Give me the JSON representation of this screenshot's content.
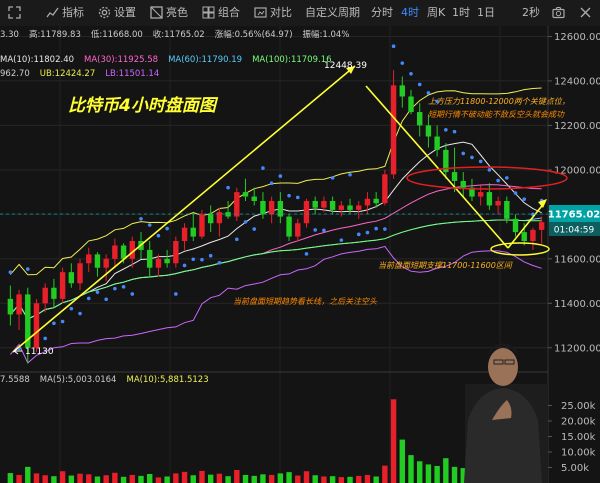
{
  "toolbar": {
    "indicators": "指标",
    "settings": "设置",
    "theme": "亮色",
    "combo": "组合",
    "compare": "对比",
    "custom_period": "自定义周期",
    "periods": [
      "分时",
      "4时",
      "周K",
      "1时",
      "1日"
    ],
    "active_period": "4时",
    "refresh": "2秒"
  },
  "info_line1": [
    {
      "text": "3.30",
      "color": "#cccccc"
    },
    {
      "text": "高:11789.83",
      "color": "#cccccc"
    },
    {
      "text": "低:11668.00",
      "color": "#cccccc"
    },
    {
      "text": "收:11765.02",
      "color": "#cccccc"
    },
    {
      "text": "涨幅:0.56%(64.97)",
      "color": "#cccccc"
    },
    {
      "text": "振幅:1.04%",
      "color": "#cccccc"
    }
  ],
  "info_line2": [
    {
      "text": "MA(10):11802.40",
      "color": "#e8e8e8"
    },
    {
      "text": "MA(30):11925.58",
      "color": "#ff66cc"
    },
    {
      "text": "MA(60):11790.19",
      "color": "#55ccff"
    },
    {
      "text": "MA(100):11709.16",
      "color": "#77ff77"
    }
  ],
  "info_line3": [
    {
      "text": "962.70",
      "color": "#cccccc"
    },
    {
      "text": "UB:12424.27",
      "color": "#eeee55"
    },
    {
      "text": "LB:11501.14",
      "color": "#cc66ff"
    }
  ],
  "volume_info": [
    {
      "text": "7.5588",
      "color": "#cccccc"
    },
    {
      "text": "MA(5):5,003.0164",
      "color": "#cccccc"
    },
    {
      "text": "MA(10):5,881.5123",
      "color": "#eeee55"
    }
  ],
  "annotations": {
    "title": "比特币4小时盘面图",
    "top_right_1": "上方压力11800-12000两个关键点位，",
    "top_right_2": "短期行情不破动能不敌反空头就会成功",
    "support": "当前盘面短期支撑11700-11600区间",
    "bottom": "当前盘面短期趋势看长线，之后关注空头",
    "high_label": "12448.39",
    "low_label": "11130"
  },
  "price_axis": {
    "ticks": [
      "12600.00",
      "12400.00",
      "12200.00",
      "12000.00",
      "11800.00",
      "11600.00",
      "11400.00",
      "11200.00"
    ],
    "current_price": "11765.02",
    "countdown": "01:04:59"
  },
  "volume_axis": {
    "ticks": [
      "25.00k",
      "20.00k",
      "15.00k",
      "10.00k",
      "5.00k"
    ]
  },
  "colors": {
    "up": "#e8202a",
    "down": "#22cc22",
    "ma10": "#e8e8e8",
    "ma30": "#ff66cc",
    "ma60": "#55ccff",
    "ma100": "#77ff77",
    "ub": "#eeee55",
    "lb": "#cc66ff",
    "sar": "#4488ff",
    "annotation_arrow": "#ffff33",
    "price_tag": "#00a3a3"
  },
  "chart_data": {
    "type": "candlestick",
    "period": "4时",
    "y_range": [
      11130,
      12600
    ],
    "candles": [
      {
        "o": 11420,
        "h": 11480,
        "l": 11300,
        "c": 11350
      },
      {
        "o": 11350,
        "h": 11460,
        "l": 11280,
        "c": 11440
      },
      {
        "o": 11440,
        "h": 11470,
        "l": 11130,
        "c": 11200
      },
      {
        "o": 11200,
        "h": 11420,
        "l": 11180,
        "c": 11400
      },
      {
        "o": 11400,
        "h": 11490,
        "l": 11360,
        "c": 11470
      },
      {
        "o": 11470,
        "h": 11510,
        "l": 11380,
        "c": 11420
      },
      {
        "o": 11420,
        "h": 11560,
        "l": 11400,
        "c": 11540
      },
      {
        "o": 11540,
        "h": 11580,
        "l": 11470,
        "c": 11490
      },
      {
        "o": 11490,
        "h": 11600,
        "l": 11460,
        "c": 11580
      },
      {
        "o": 11580,
        "h": 11650,
        "l": 11540,
        "c": 11620
      },
      {
        "o": 11620,
        "h": 11630,
        "l": 11520,
        "c": 11560
      },
      {
        "o": 11560,
        "h": 11620,
        "l": 11500,
        "c": 11600
      },
      {
        "o": 11600,
        "h": 11690,
        "l": 11560,
        "c": 11660
      },
      {
        "o": 11660,
        "h": 11670,
        "l": 11580,
        "c": 11600
      },
      {
        "o": 11600,
        "h": 11700,
        "l": 11560,
        "c": 11680
      },
      {
        "o": 11680,
        "h": 11720,
        "l": 11600,
        "c": 11640
      },
      {
        "o": 11640,
        "h": 11680,
        "l": 11520,
        "c": 11560
      },
      {
        "o": 11560,
        "h": 11620,
        "l": 11520,
        "c": 11600
      },
      {
        "o": 11600,
        "h": 11640,
        "l": 11560,
        "c": 11580
      },
      {
        "o": 11580,
        "h": 11700,
        "l": 11560,
        "c": 11680
      },
      {
        "o": 11680,
        "h": 11760,
        "l": 11640,
        "c": 11740
      },
      {
        "o": 11740,
        "h": 11800,
        "l": 11680,
        "c": 11700
      },
      {
        "o": 11700,
        "h": 11820,
        "l": 11690,
        "c": 11800
      },
      {
        "o": 11800,
        "h": 11840,
        "l": 11720,
        "c": 11760
      },
      {
        "o": 11760,
        "h": 11830,
        "l": 11700,
        "c": 11810
      },
      {
        "o": 11810,
        "h": 11860,
        "l": 11780,
        "c": 11790
      },
      {
        "o": 11790,
        "h": 11920,
        "l": 11770,
        "c": 11900
      },
      {
        "o": 11900,
        "h": 11960,
        "l": 11860,
        "c": 11880
      },
      {
        "o": 11880,
        "h": 11920,
        "l": 11840,
        "c": 11860
      },
      {
        "o": 11860,
        "h": 11900,
        "l": 11780,
        "c": 11800
      },
      {
        "o": 11800,
        "h": 11880,
        "l": 11760,
        "c": 11860
      },
      {
        "o": 11860,
        "h": 11900,
        "l": 11760,
        "c": 11790
      },
      {
        "o": 11790,
        "h": 11800,
        "l": 11680,
        "c": 11700
      },
      {
        "o": 11700,
        "h": 11780,
        "l": 11680,
        "c": 11760
      },
      {
        "o": 11760,
        "h": 11870,
        "l": 11740,
        "c": 11860
      },
      {
        "o": 11860,
        "h": 11880,
        "l": 11800,
        "c": 11830
      },
      {
        "o": 11830,
        "h": 11880,
        "l": 11810,
        "c": 11860
      },
      {
        "o": 11860,
        "h": 11880,
        "l": 11800,
        "c": 11820
      },
      {
        "o": 11820,
        "h": 11860,
        "l": 11790,
        "c": 11840
      },
      {
        "o": 11840,
        "h": 11870,
        "l": 11800,
        "c": 11820
      },
      {
        "o": 11820,
        "h": 11860,
        "l": 11780,
        "c": 11840
      },
      {
        "o": 11840,
        "h": 11900,
        "l": 11800,
        "c": 11870
      },
      {
        "o": 11870,
        "h": 11900,
        "l": 11830,
        "c": 11850
      },
      {
        "o": 11850,
        "h": 12000,
        "l": 11840,
        "c": 11980
      },
      {
        "o": 11980,
        "h": 12448,
        "l": 11960,
        "c": 12380
      },
      {
        "o": 12380,
        "h": 12420,
        "l": 12280,
        "c": 12330
      },
      {
        "o": 12330,
        "h": 12360,
        "l": 12250,
        "c": 12260
      },
      {
        "o": 12260,
        "h": 12300,
        "l": 12150,
        "c": 12200
      },
      {
        "o": 12200,
        "h": 12250,
        "l": 12100,
        "c": 12150
      },
      {
        "o": 12150,
        "h": 12200,
        "l": 12060,
        "c": 12090
      },
      {
        "o": 12090,
        "h": 12120,
        "l": 11960,
        "c": 11990
      },
      {
        "o": 11990,
        "h": 12100,
        "l": 11900,
        "c": 11950
      },
      {
        "o": 11950,
        "h": 11990,
        "l": 11880,
        "c": 11920
      },
      {
        "o": 11920,
        "h": 11960,
        "l": 11860,
        "c": 11880
      },
      {
        "o": 11880,
        "h": 11930,
        "l": 11840,
        "c": 11900
      },
      {
        "o": 11900,
        "h": 11940,
        "l": 11820,
        "c": 11840
      },
      {
        "o": 11840,
        "h": 11880,
        "l": 11800,
        "c": 11860
      },
      {
        "o": 11860,
        "h": 11880,
        "l": 11760,
        "c": 11780
      },
      {
        "o": 11780,
        "h": 11800,
        "l": 11700,
        "c": 11720
      },
      {
        "o": 11720,
        "h": 11760,
        "l": 11660,
        "c": 11680
      },
      {
        "o": 11680,
        "h": 11740,
        "l": 11640,
        "c": 11730
      },
      {
        "o": 11730,
        "h": 11790,
        "l": 11668,
        "c": 11765
      }
    ],
    "volume": [
      3200,
      2600,
      5200,
      3100,
      2500,
      2200,
      3800,
      2400,
      3000,
      2800,
      2100,
      2500,
      3300,
      2000,
      2600,
      2300,
      2900,
      1800,
      2100,
      3100,
      3600,
      2500,
      3900,
      2700,
      3000,
      2200,
      4200,
      2600,
      2300,
      2800,
      2600,
      3100,
      3500,
      2400,
      3800,
      2500,
      2100,
      2200,
      1900,
      2000,
      2300,
      2600,
      2100,
      5600,
      27000,
      14000,
      9000,
      7000,
      6000,
      5500,
      8000,
      5200,
      4800,
      4000,
      4300,
      4600,
      3800,
      4500,
      5200,
      4900,
      3700,
      3600
    ],
    "volume_ylim": [
      0,
      30000
    ]
  }
}
